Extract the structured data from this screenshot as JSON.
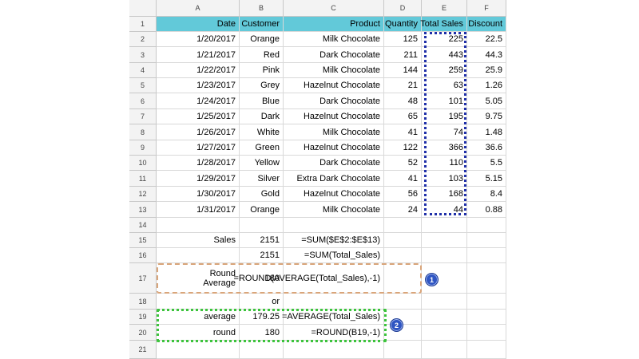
{
  "columns": [
    "A",
    "B",
    "C",
    "D",
    "E",
    "F"
  ],
  "rows": [
    "1",
    "2",
    "3",
    "4",
    "5",
    "6",
    "7",
    "8",
    "9",
    "10",
    "11",
    "12",
    "13",
    "14",
    "15",
    "16",
    "17",
    "18",
    "19",
    "20",
    "21"
  ],
  "headers": {
    "date": "Date",
    "customer": "Customer",
    "product": "Product",
    "quantity": "Quantity",
    "total_sales": "Total Sales",
    "discount": "Discount"
  },
  "data_rows": [
    {
      "date": "1/20/2017",
      "customer": "Orange",
      "product": "Milk Chocolate",
      "quantity": "125",
      "total_sales": "225",
      "discount": "22.5"
    },
    {
      "date": "1/21/2017",
      "customer": "Red",
      "product": "Dark Chocolate",
      "quantity": "211",
      "total_sales": "443",
      "discount": "44.3"
    },
    {
      "date": "1/22/2017",
      "customer": "Pink",
      "product": "Milk Chocolate",
      "quantity": "144",
      "total_sales": "259",
      "discount": "25.9"
    },
    {
      "date": "1/23/2017",
      "customer": "Grey",
      "product": "Hazelnut Chocolate",
      "quantity": "21",
      "total_sales": "63",
      "discount": "1.26"
    },
    {
      "date": "1/24/2017",
      "customer": "Blue",
      "product": "Dark Chocolate",
      "quantity": "48",
      "total_sales": "101",
      "discount": "5.05"
    },
    {
      "date": "1/25/2017",
      "customer": "Dark",
      "product": "Hazelnut Chocolate",
      "quantity": "65",
      "total_sales": "195",
      "discount": "9.75"
    },
    {
      "date": "1/26/2017",
      "customer": "White",
      "product": "Milk Chocolate",
      "quantity": "41",
      "total_sales": "74",
      "discount": "1.48"
    },
    {
      "date": "1/27/2017",
      "customer": "Green",
      "product": "Hazelnut Chocolate",
      "quantity": "122",
      "total_sales": "366",
      "discount": "36.6"
    },
    {
      "date": "1/28/2017",
      "customer": "Yellow",
      "product": "Dark Chocolate",
      "quantity": "52",
      "total_sales": "110",
      "discount": "5.5"
    },
    {
      "date": "1/29/2017",
      "customer": "Silver",
      "product": "Extra Dark Chocolate",
      "quantity": "41",
      "total_sales": "103",
      "discount": "5.15"
    },
    {
      "date": "1/30/2017",
      "customer": "Gold",
      "product": "Hazelnut Chocolate",
      "quantity": "56",
      "total_sales": "168",
      "discount": "8.4"
    },
    {
      "date": "1/31/2017",
      "customer": "Orange",
      "product": "Milk Chocolate",
      "quantity": "24",
      "total_sales": "44",
      "discount": "0.88"
    }
  ],
  "summary": {
    "r15_label": "Sales",
    "r15_value": "2151",
    "r15_formula": "=SUM($E$2:$E$13)",
    "r16_value": "2151",
    "r16_formula": "=SUM(Total_Sales)",
    "r17_label": "Round Average",
    "r17_value": "180",
    "r17_formula": "=ROUND(AVERAGE(Total_Sales),-1)",
    "r18_text": "or",
    "r19_label": "average",
    "r19_value": "179.25",
    "r19_formula": "=AVERAGE(Total_Sales)",
    "r20_label": "round",
    "r20_value": "180",
    "r20_formula": "=ROUND(B19,-1)"
  },
  "badges": {
    "one": "1",
    "two": "2"
  },
  "colors": {
    "header_fill": "#62c9d9",
    "total_sales_outline": "#1f2fa8",
    "box1_outline": "#d9a57a",
    "box2_outline": "#3cc33c",
    "badge_fill": "#2f55c2"
  }
}
